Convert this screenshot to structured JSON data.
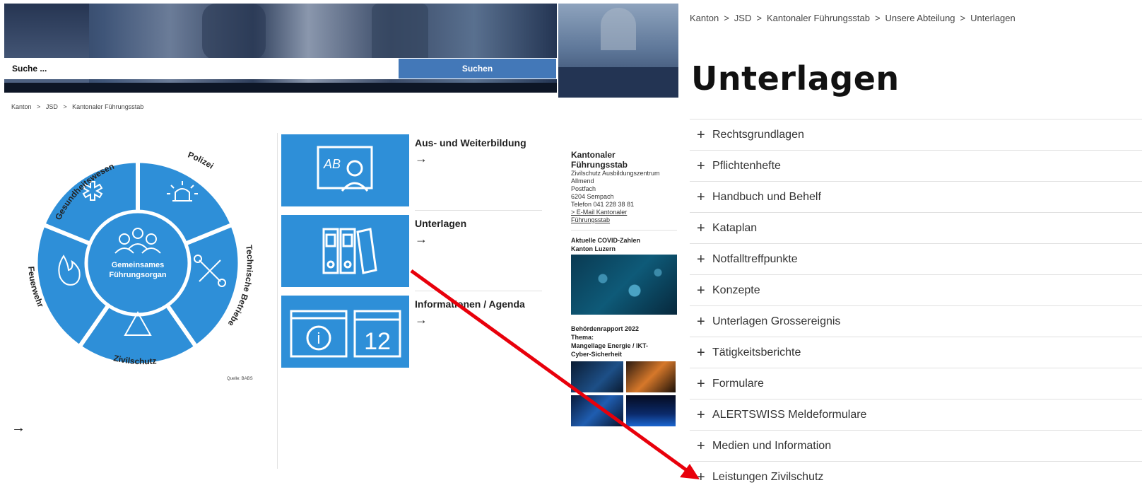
{
  "left": {
    "search": {
      "placeholder": "Suche ...",
      "button_label": "Suchen"
    },
    "breadcrumb": [
      "Kanton",
      "JSD",
      "Kantonaler Führungsstab"
    ],
    "breadcrumb_sep": ">",
    "wheel": {
      "center_line1": "Gemeinsames",
      "center_line2": "Führungsorgan",
      "segments": [
        "Gesundheitswesen",
        "Polizei",
        "Technische Betriebe",
        "Zivilschutz",
        "Feuerwehr"
      ],
      "source": "Quelle: BABS"
    },
    "arrow": "→",
    "tiles": [
      {
        "title": "Aus- und Weiterbildung",
        "arrow": "→",
        "icon": "teacher-board-icon"
      },
      {
        "title": "Unterlagen",
        "arrow": "→",
        "icon": "binders-icon"
      },
      {
        "title": "Informationen / Agenda",
        "arrow": "→",
        "icon": "info-calendar-icon"
      }
    ],
    "calendar_day": "12"
  },
  "sidebar": {
    "contact_title_1": "Kantonaler",
    "contact_title_2": "Führungsstab",
    "address": [
      "Zivilschutz Ausbildungszentrum",
      "Allmend",
      "Postfach",
      "6204 Sempach",
      "Telefon 041 228 38 81"
    ],
    "email_link_1": "> E-Mail Kantonaler",
    "email_link_2": "Führungsstab",
    "covid_title_1": "Aktuelle COVID-Zahlen",
    "covid_title_2": "Kanton Luzern",
    "report_title_1": "Behördenrapport 2022",
    "report_title_2": "Thema:",
    "report_title_3": "Mangellage Energie / IKT-",
    "report_title_4": "Cyber-Sicherheit"
  },
  "right": {
    "breadcrumb": [
      "Kanton",
      "JSD",
      "Kantonaler Führungsstab",
      "Unsere Abteilung",
      "Unterlagen"
    ],
    "breadcrumb_sep": ">",
    "title": "Unterlagen",
    "plus": "+",
    "accordion": [
      "Rechtsgrundlagen",
      "Pflichtenhefte",
      "Handbuch und Behelf",
      "Kataplan",
      "Notfalltreffpunkte",
      "Konzepte",
      "Unterlagen Grossereignis",
      "Tätigkeitsberichte",
      "Formulare",
      "ALERTSWISS Meldeformulare",
      "Medien und Information",
      "Leistungen Zivilschutz"
    ]
  },
  "colors": {
    "brand_blue": "#2e8fd8",
    "button_blue": "#4378b8",
    "annotation_red": "#e8000b"
  }
}
